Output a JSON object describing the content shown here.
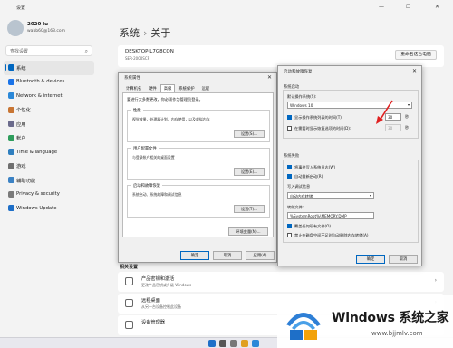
{
  "titlebar": {
    "title": "设置",
    "minimize": "—",
    "maximize": "☐",
    "close": "✕"
  },
  "user": {
    "name": "2020 lu",
    "email": "wabb60@163.com"
  },
  "search": {
    "placeholder": "查找设置"
  },
  "nav": [
    {
      "label": "系统",
      "color": "#0067c0",
      "active": true
    },
    {
      "label": "Bluetooth & devices",
      "color": "#1a73e8"
    },
    {
      "label": "Network & internet",
      "color": "#2b88d8"
    },
    {
      "label": "个性化",
      "color": "#c87533"
    },
    {
      "label": "应用",
      "color": "#6b6b8c"
    },
    {
      "label": "帐户",
      "color": "#2e9d5c"
    },
    {
      "label": "Time & language",
      "color": "#2f7fbf"
    },
    {
      "label": "游戏",
      "color": "#6f6f6f"
    },
    {
      "label": "辅助功能",
      "color": "#3b82c4"
    },
    {
      "label": "Privacy & security",
      "color": "#7a7a7a"
    },
    {
      "label": "Windows Update",
      "color": "#1e6fc8"
    }
  ],
  "breadcrumb": {
    "parent": "系统",
    "sep": "›",
    "current": "关于"
  },
  "device": {
    "name": "DESKTOP-L7G8CON",
    "subtitle": "SER-2000SCF",
    "rename_label": "重命名这台电脑"
  },
  "related": {
    "heading": "相关设置",
    "items": [
      {
        "title": "产品密钥和激活",
        "subtitle": "更改产品密钥或升级 Windows",
        "arrow": "›"
      },
      {
        "title": "远程桌面",
        "subtitle": "从另一台设备控制此设备",
        "arrow": "›"
      },
      {
        "title": "设备管理器",
        "subtitle": "",
        "arrow": "›"
      }
    ]
  },
  "sysprops": {
    "title": "系统属性",
    "close": "✕",
    "tabs": [
      "计算机名",
      "硬件",
      "高级",
      "系统保护",
      "远程"
    ],
    "note": "要进行大多数更改，你必须作为管理员登录。",
    "groups": [
      {
        "title": "性能",
        "desc": "视觉效果，处理器计划，内存使用，以及虚拟内存",
        "button": "设置(S)..."
      },
      {
        "title": "用户配置文件",
        "desc": "与登录帐户相关的桌面设置",
        "button": "设置(E)..."
      },
      {
        "title": "启动和故障恢复",
        "desc": "系统启动、系统故障和调试信息",
        "button": "设置(T)..."
      }
    ],
    "env_button": "环境变量(N)...",
    "buttons": [
      "确定",
      "取消",
      "应用(A)"
    ]
  },
  "startup": {
    "title": "启动和故障恢复",
    "close": "✕",
    "section1": "系统启动",
    "default_os_label": "默认操作系统(S):",
    "default_os_value": "Windows 10",
    "show_os_list_label": "显示操作系统列表的时间(T):",
    "show_os_list_value": "30",
    "show_os_list_checked": true,
    "recovery_label": "在需要时显示恢复选项的时间(D):",
    "recovery_value": "30",
    "recovery_checked": false,
    "unit": "秒",
    "section2": "系统失败",
    "write_event_label": "将事件写入系统日志(W)",
    "write_event_checked": true,
    "auto_restart_label": "自动重新启动(R)",
    "auto_restart_checked": true,
    "debug_info_label": "写入调试信息",
    "debug_info_value": "自动内存转储",
    "dump_file_label": "转储文件:",
    "dump_file_value": "%SystemRoot%\\MEMORY.DMP",
    "overwrite_label": "覆盖任何现有文件(O)",
    "overwrite_checked": true,
    "disable_auto_delete_label": "禁止在磁盘空间不足时自动删除内存转储(A)",
    "disable_auto_delete_checked": false,
    "ok": "确定",
    "cancel": "取消"
  },
  "watermark": {
    "title": "Windows 系统之家",
    "site": "www.bjjmlv.com"
  }
}
